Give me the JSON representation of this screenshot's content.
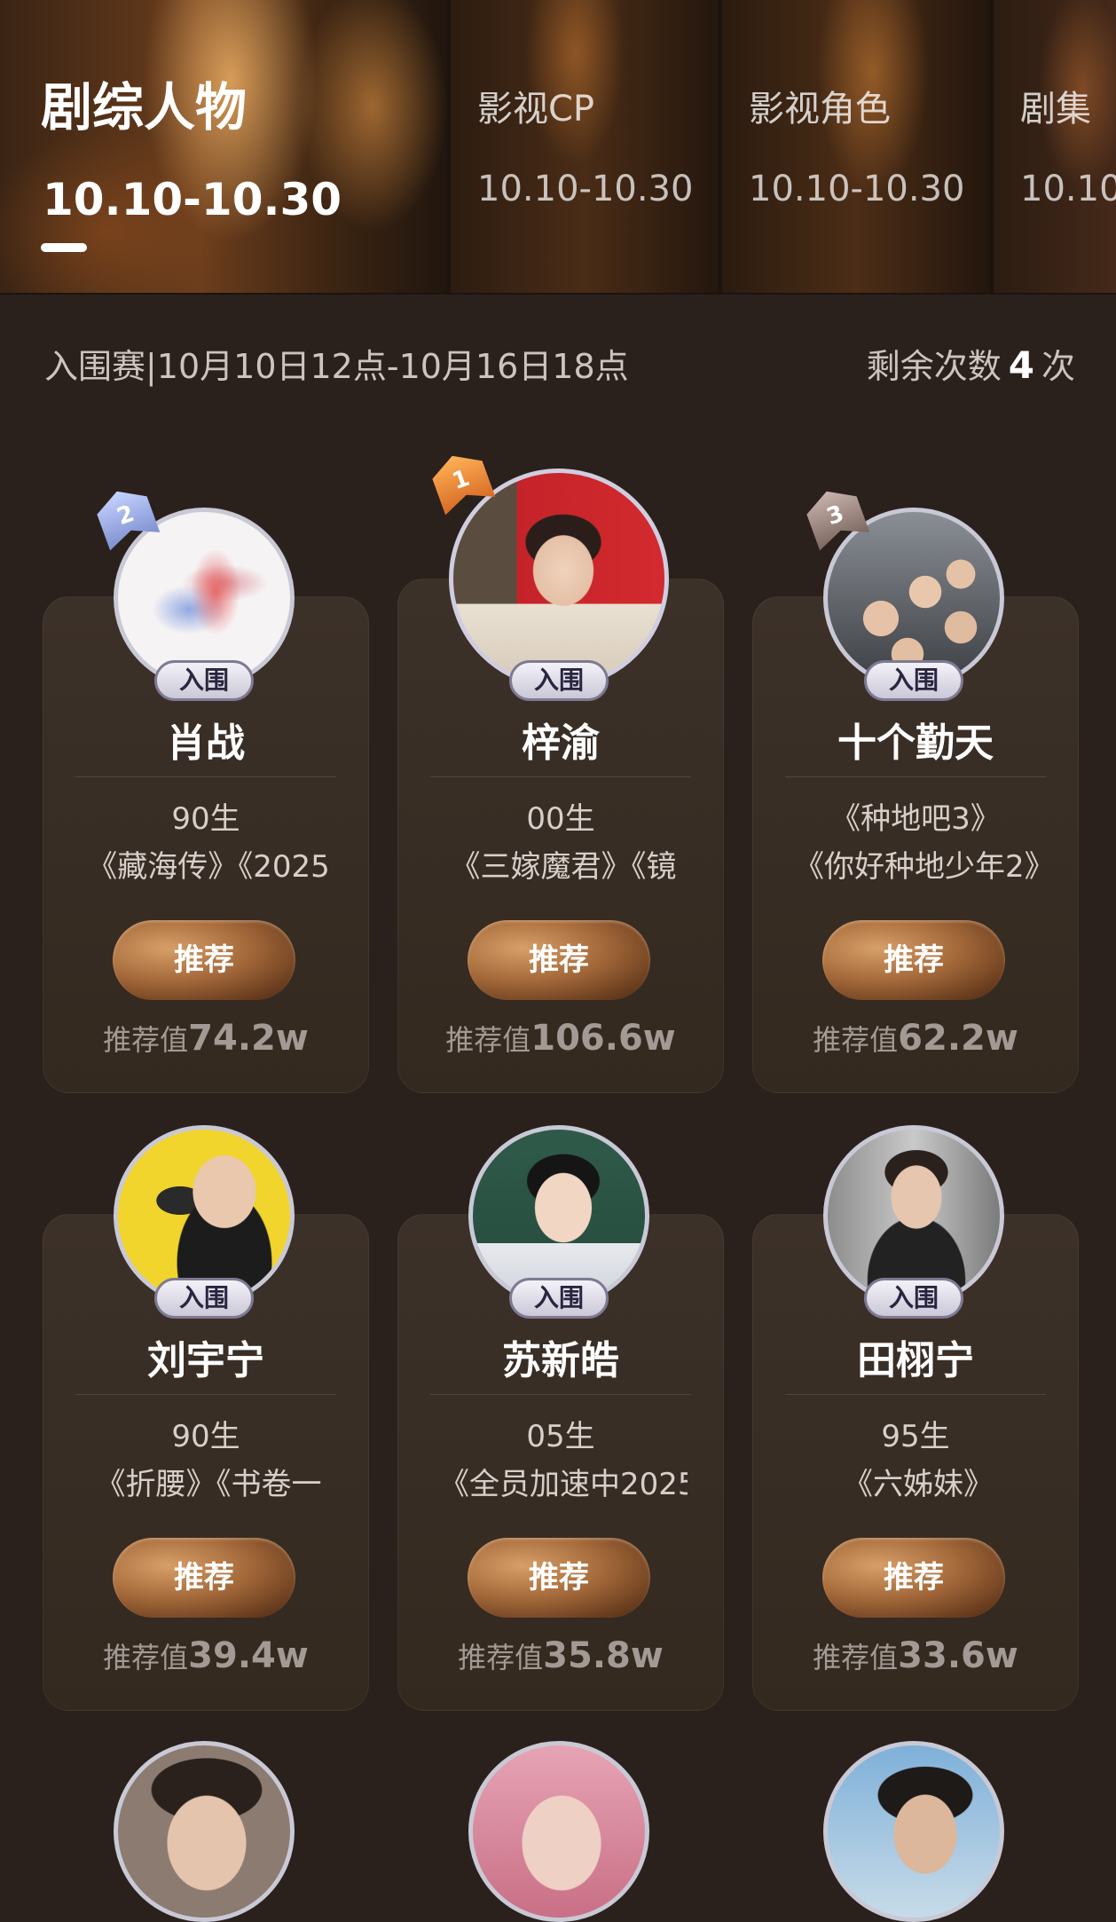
{
  "tabs": [
    {
      "label": "剧综人物",
      "date": "10.10-10.30"
    },
    {
      "label": "影视CP",
      "date": "10.10-10.30"
    },
    {
      "label": "影视角色",
      "date": "10.10-10.30"
    },
    {
      "label": "剧集",
      "date": "10.10-"
    }
  ],
  "info": {
    "round": "入围赛|10月10日12点-10月16日18点",
    "remain_prefix": "剩余次数",
    "remain_count": "4",
    "remain_suffix": "次"
  },
  "cards": [
    {
      "name": "肖战",
      "tag": "入围",
      "rank": "2",
      "birth": "90生",
      "works": "《藏海传》《2025",
      "button": "推荐",
      "score_label": "推荐值",
      "score": "74.2w"
    },
    {
      "name": "梓渝",
      "tag": "入围",
      "rank": "1",
      "birth": "00生",
      "works": "《三嫁魔君》《镜",
      "button": "推荐",
      "score_label": "推荐值",
      "score": "106.6w"
    },
    {
      "name": "十个勤天",
      "tag": "入围",
      "rank": "3",
      "birth": "《种地吧3》",
      "works": "《你好种地少年2》",
      "button": "推荐",
      "score_label": "推荐值",
      "score": "62.2w"
    },
    {
      "name": "刘宇宁",
      "tag": "入围",
      "birth": "90生",
      "works": "《折腰》《书卷一",
      "button": "推荐",
      "score_label": "推荐值",
      "score": "39.4w"
    },
    {
      "name": "苏新皓",
      "tag": "入围",
      "birth": "05生",
      "works": "《全员加速中2025",
      "button": "推荐",
      "score_label": "推荐值",
      "score": "35.8w"
    },
    {
      "name": "田栩宁",
      "tag": "入围",
      "birth": "95生",
      "works": "《六姊妹》",
      "button": "推荐",
      "score_label": "推荐值",
      "score": "33.6w"
    }
  ],
  "colors": {
    "accent": "#a4693a",
    "background": "#2a211d",
    "card": "#3a2f27"
  }
}
